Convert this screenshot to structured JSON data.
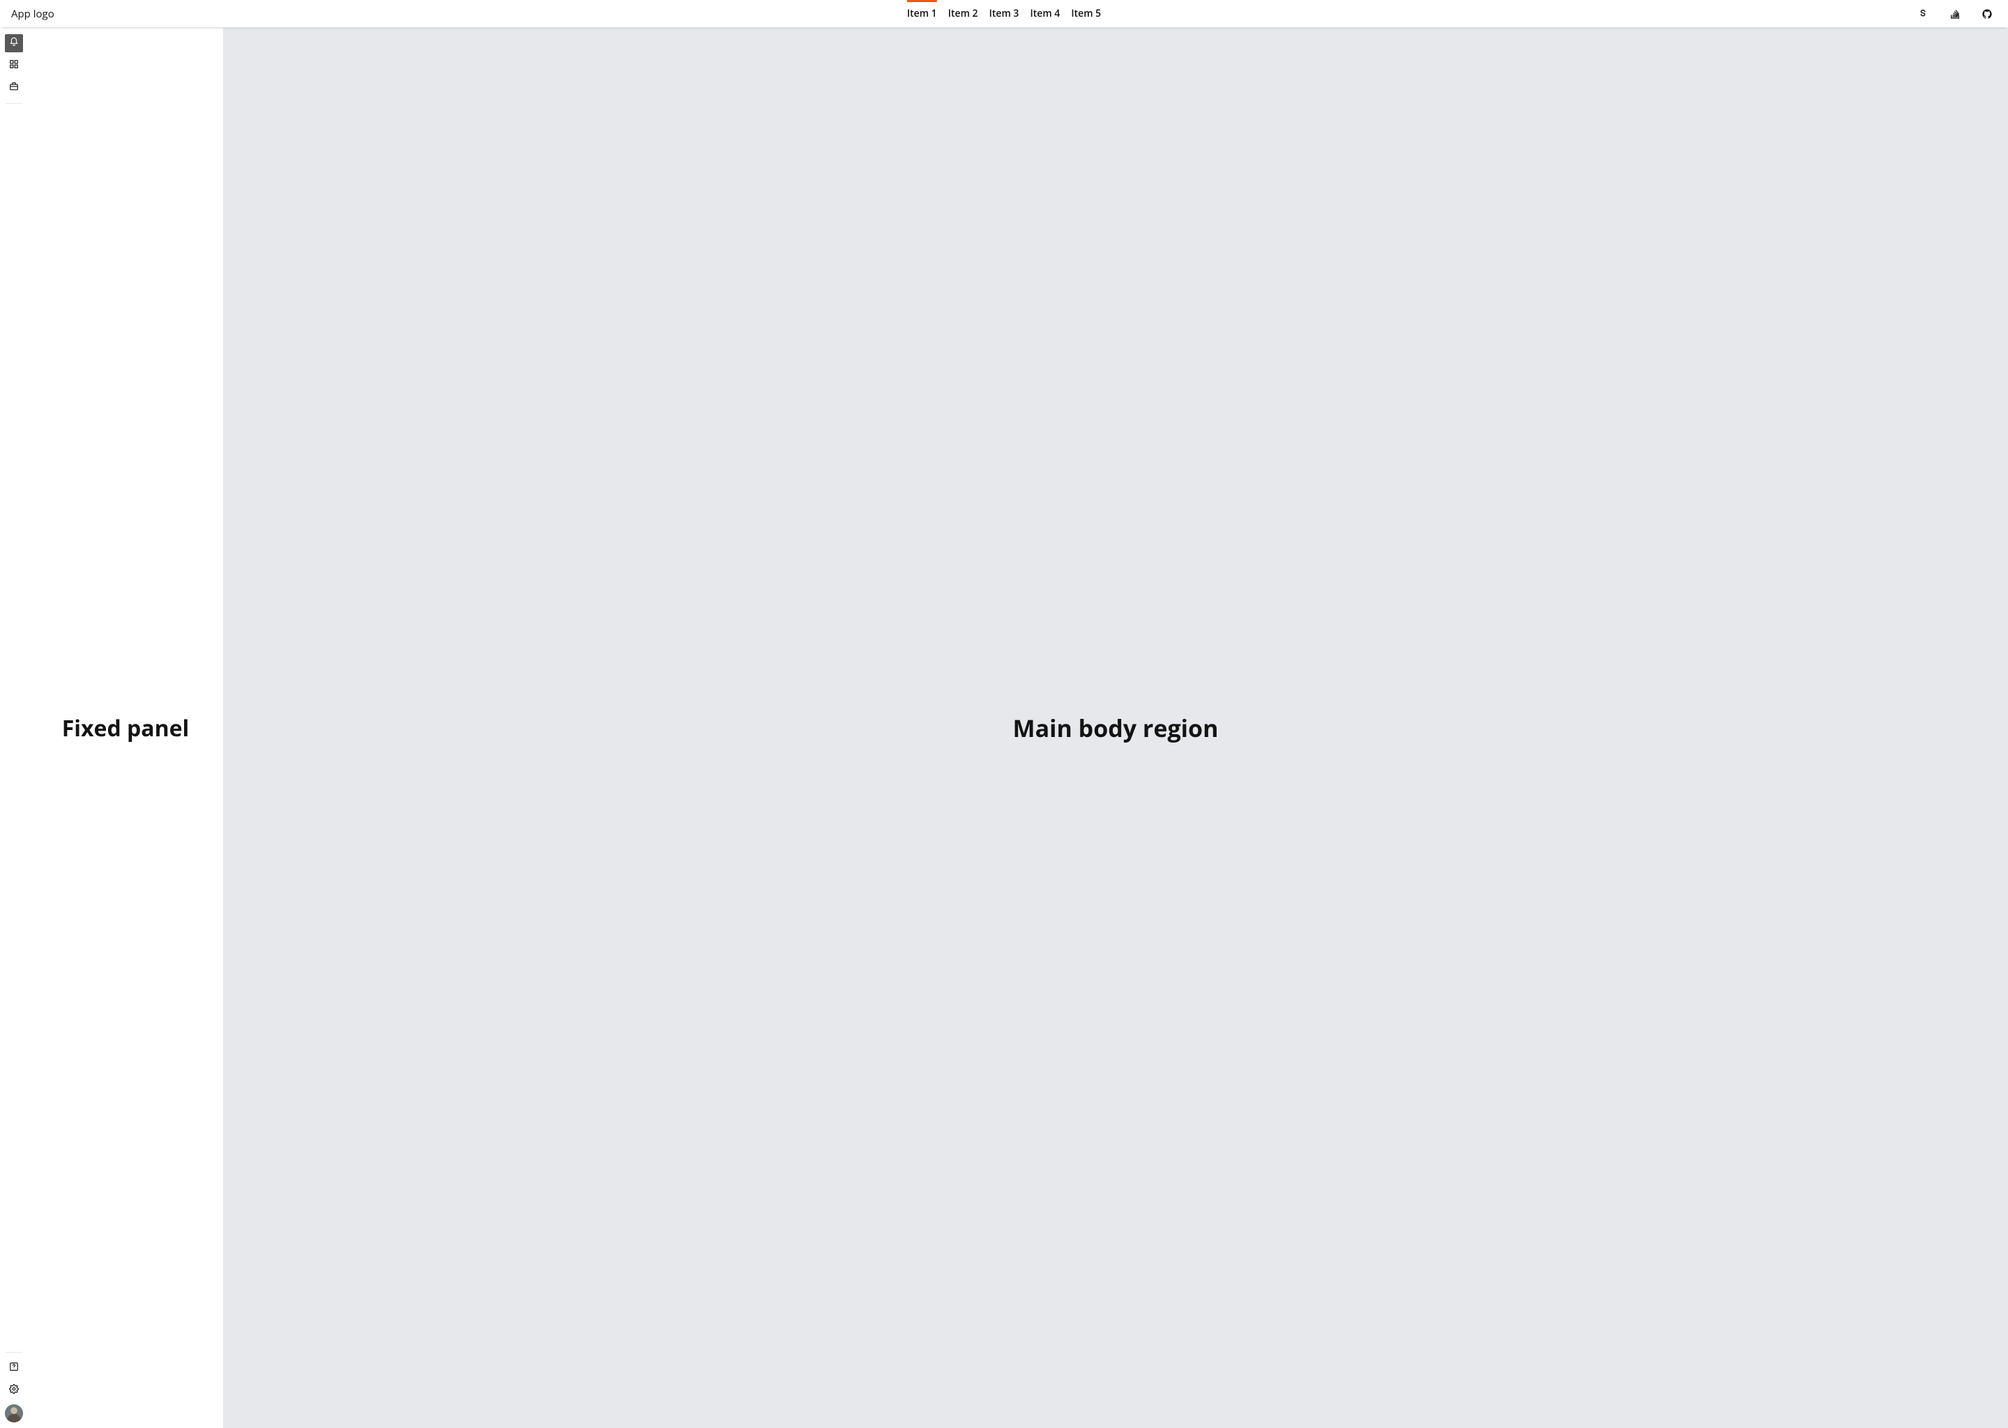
{
  "header": {
    "logo": "App logo",
    "nav": [
      {
        "label": "Item 1",
        "active": true
      },
      {
        "label": "Item 2",
        "active": false
      },
      {
        "label": "Item 3",
        "active": false
      },
      {
        "label": "Item 4",
        "active": false
      },
      {
        "label": "Item 5",
        "active": false
      }
    ],
    "end_icons": [
      {
        "name": "s-logo-icon"
      },
      {
        "name": "stackoverflow-icon"
      },
      {
        "name": "github-icon"
      }
    ]
  },
  "rail": {
    "top": [
      {
        "name": "bell-icon",
        "active": true
      },
      {
        "name": "grid-icon",
        "active": false
      },
      {
        "name": "briefcase-icon",
        "active": false
      }
    ],
    "bottom": [
      {
        "name": "help-icon",
        "active": false
      },
      {
        "name": "gear-icon",
        "active": false
      }
    ]
  },
  "panel": {
    "title": "Fixed panel"
  },
  "main": {
    "title": "Main body region"
  }
}
